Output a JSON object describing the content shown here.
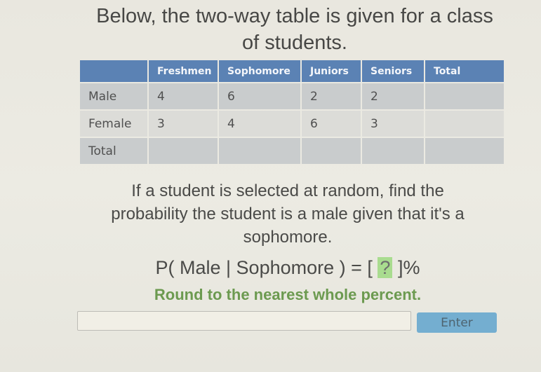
{
  "intro": {
    "line1": "Below, the two-way table is given for a class",
    "line2": "of students."
  },
  "table": {
    "headers": [
      "",
      "Freshmen",
      "Sophomore",
      "Juniors",
      "Seniors",
      "Total"
    ],
    "rows": [
      {
        "label": "Male",
        "cells": [
          "4",
          "6",
          "2",
          "2",
          ""
        ]
      },
      {
        "label": "Female",
        "cells": [
          "3",
          "4",
          "6",
          "3",
          ""
        ]
      },
      {
        "label": "Total",
        "cells": [
          "",
          "",
          "",
          "",
          ""
        ]
      }
    ]
  },
  "question": {
    "line1": "If a student is selected at random, find the",
    "line2": "probability the student is a male given that it's a",
    "line3": "sophomore."
  },
  "equation": {
    "prefix": "P( Male | Sophomore ) = [",
    "blank": "?",
    "suffix": "]%"
  },
  "hint": "Round to the nearest whole percent.",
  "answer": {
    "value": "",
    "placeholder": ""
  },
  "enter_button": {
    "label": "Enter",
    "color": "#74aed0"
  },
  "colors": {
    "table_header": "#5b82b4",
    "hint_text": "#6c9a50",
    "blank_highlight": "#a9dc8f"
  }
}
